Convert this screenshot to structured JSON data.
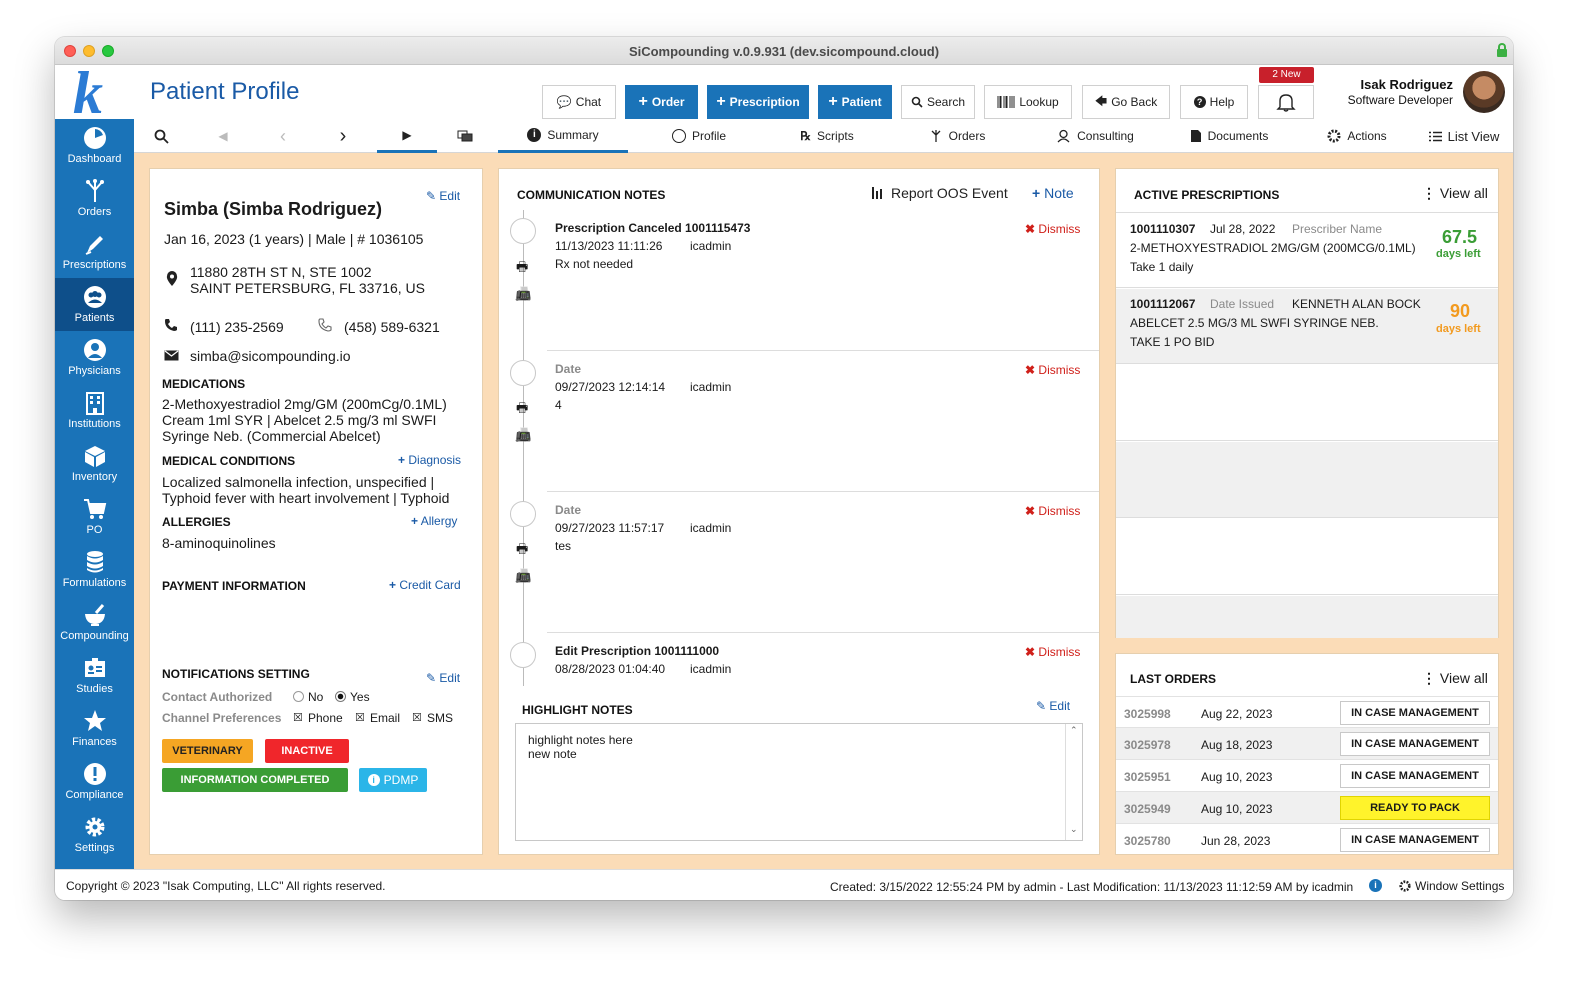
{
  "window": {
    "title": "SiCompounding v.0.9.931 (dev.sicompound.cloud)"
  },
  "sidebar": {
    "logo": "k",
    "items": [
      {
        "label": "Dashboard"
      },
      {
        "label": "Orders"
      },
      {
        "label": "Prescriptions"
      },
      {
        "label": "Patients"
      },
      {
        "label": "Physicians"
      },
      {
        "label": "Institutions"
      },
      {
        "label": "Inventory"
      },
      {
        "label": "PO"
      },
      {
        "label": "Formulations"
      },
      {
        "label": "Compounding"
      },
      {
        "label": "Studies"
      },
      {
        "label": "Finances"
      },
      {
        "label": "Compliance"
      },
      {
        "label": "Settings"
      }
    ],
    "active": "Patients"
  },
  "header": {
    "title": "Patient Profile",
    "buttons": {
      "chat": "Chat",
      "order": "Order",
      "prescription": "Prescription",
      "patient": "Patient",
      "search": "Search",
      "lookup": "Lookup",
      "go_back": "Go Back",
      "help": "Help"
    },
    "notifications_badge": "2 New",
    "user": {
      "name": "Isak Rodriguez",
      "role": "Software Developer"
    }
  },
  "tabs": {
    "summary": "Summary",
    "profile": "Profile",
    "scripts": "Scripts",
    "orders": "Orders",
    "consulting": "Consulting",
    "documents": "Documents",
    "actions": "Actions",
    "list_view": "List View"
  },
  "patient": {
    "edit": "Edit",
    "name": "Simba (Simba Rodriguez)",
    "info": "Jan 16, 2023 (1 years) | Male | # 1036105",
    "address1": "11880 28TH ST N, STE 1002",
    "address2": "SAINT PETERSBURG, FL 33716, US",
    "phone1": "(111) 235-2569",
    "phone2": "(458) 589-6321",
    "email": "simba@sicompounding.io",
    "medications_h": "MEDICATIONS",
    "medications_l1": "2-Methoxyestradiol 2mg/GM (200mCg/0.1ML)",
    "medications_l2": "Cream 1ml SYR  | Abelcet 2.5 mg/3 ml SWFI",
    "medications_l3": "Syringe Neb. (Commercial Abelcet)",
    "conditions_h": "MEDICAL CONDITIONS",
    "diagnosis_link": "Diagnosis",
    "conditions_l1": "Localized salmonella infection, unspecified |",
    "conditions_l2": "Typhoid fever with heart involvement | Typhoid",
    "allergies_h": "ALLERGIES",
    "allergy_link": "Allergy",
    "allergies": "8-aminoquinolines",
    "payment_h": "PAYMENT INFORMATION",
    "credit_card_link": "Credit Card",
    "notif_h": "NOTIFICATIONS SETTING",
    "notif_edit": "Edit",
    "contact_authorized": "Contact Authorized",
    "no": "No",
    "yes": "Yes",
    "channel_prefs": "Channel Preferences",
    "phone": "Phone",
    "email_opt": "Email",
    "sms": "SMS",
    "tags": {
      "veterinary": "VETERINARY",
      "inactive": "INACTIVE",
      "info_completed": "INFORMATION COMPLETED",
      "pdmp": "PDMP"
    }
  },
  "communication": {
    "title": "COMMUNICATION NOTES",
    "report_oos": "Report OOS Event",
    "note_link": "Note",
    "dismiss": "Dismiss",
    "notes": [
      {
        "title": "Prescription Canceled 1001115473",
        "datetime": "11/13/2023 11:11:26",
        "user": "icadmin",
        "body": "Rx not needed"
      },
      {
        "title": "Date",
        "datetime": "09/27/2023 12:14:14",
        "user": "icadmin",
        "body": "4"
      },
      {
        "title": "Date",
        "datetime": "09/27/2023 11:57:17",
        "user": "icadmin",
        "body": "tes"
      },
      {
        "title": "Edit Prescription 1001111000",
        "datetime": "08/28/2023 01:04:40",
        "user": "icadmin",
        "body": ""
      }
    ],
    "highlight_h": "HIGHLIGHT NOTES",
    "highlight_edit": "Edit",
    "highlight_l1": "highlight notes here",
    "highlight_l2": "new note"
  },
  "active_rx": {
    "title": "ACTIVE PRESCRIPTIONS",
    "view_all": "View all",
    "items": [
      {
        "id": "1001110307",
        "date": "Jul 28, 2022",
        "prescriber": "Prescriber Name",
        "drug": "2-METHOXYESTRADIOL 2MG/GM (200MCG/0.1ML)",
        "sig": "Take 1 daily",
        "days": "67.5",
        "days_label": "days left"
      },
      {
        "id": "1001112067",
        "date": "Date Issued",
        "prescriber": "KENNETH ALAN BOCK",
        "drug": "ABELCET 2.5 MG/3 ML SWFI SYRINGE NEB.",
        "sig": "TAKE 1 PO BID",
        "days": "90",
        "days_label": "days left"
      }
    ]
  },
  "last_orders": {
    "title": "LAST ORDERS",
    "view_all": "View all",
    "items": [
      {
        "id": "3025998",
        "date": "Aug 22, 2023",
        "status": "IN CASE MANAGEMENT"
      },
      {
        "id": "3025978",
        "date": "Aug 18, 2023",
        "status": "IN CASE MANAGEMENT"
      },
      {
        "id": "3025951",
        "date": "Aug 10, 2023",
        "status": "IN CASE MANAGEMENT"
      },
      {
        "id": "3025949",
        "date": "Aug 10, 2023",
        "status": "READY TO PACK"
      },
      {
        "id": "3025780",
        "date": "Jun 28, 2023",
        "status": "IN CASE MANAGEMENT"
      }
    ]
  },
  "footer": {
    "copyright": "Copyright © 2023 \"Isak Computing, LLC\" All rights reserved.",
    "created": "Created: 3/15/2022 12:55:24 PM by admin - Last Modification: 11/13/2023 11:12:59 AM  by icadmin",
    "window_settings": "Window Settings"
  },
  "colors": {
    "brand": "#1a73b8",
    "content_bg": "#fbdcb7",
    "danger": "#d0201a",
    "green": "#3a9d35",
    "orange": "#f29a1f"
  }
}
